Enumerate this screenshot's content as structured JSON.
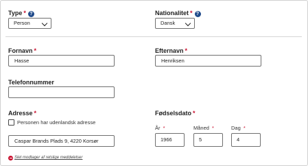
{
  "type": {
    "label": "Type",
    "required_mark": "*",
    "help_icon": "question-circle-icon",
    "help_glyph": "?",
    "selected": "Person"
  },
  "nationality": {
    "label": "Nationalitet",
    "required_mark": "*",
    "help_icon": "question-circle-icon",
    "help_glyph": "?",
    "selected": "Dansk"
  },
  "first_name": {
    "label": "Fornavn",
    "required_mark": "*",
    "value": "Hasse"
  },
  "last_name": {
    "label": "Efternavn",
    "required_mark": "*",
    "value": "Henriksen"
  },
  "phone": {
    "label": "Telefonnummer",
    "value": ""
  },
  "address": {
    "label": "Adresse",
    "required_mark": "*",
    "foreign_checkbox_label": "Personen har udenlandsk adresse",
    "foreign_checked": false,
    "value": "Caspar Brands Plads 9, 4220 Korsør"
  },
  "birthdate": {
    "label": "Fødselsdato",
    "required_mark": "*",
    "year_label": "År",
    "year_mark": "*",
    "year_value": "1966",
    "month_label": "Måned",
    "month_mark": "*",
    "month_value": "5",
    "day_label": "Dag",
    "day_mark": "*",
    "day_value": "4"
  },
  "remove": {
    "icon": "minus-circle-icon",
    "label": "Slet modtager af retslige meddelelser"
  },
  "colors": {
    "required": "#c8102e",
    "help": "#1f4a8a",
    "remove": "#c8102e"
  }
}
